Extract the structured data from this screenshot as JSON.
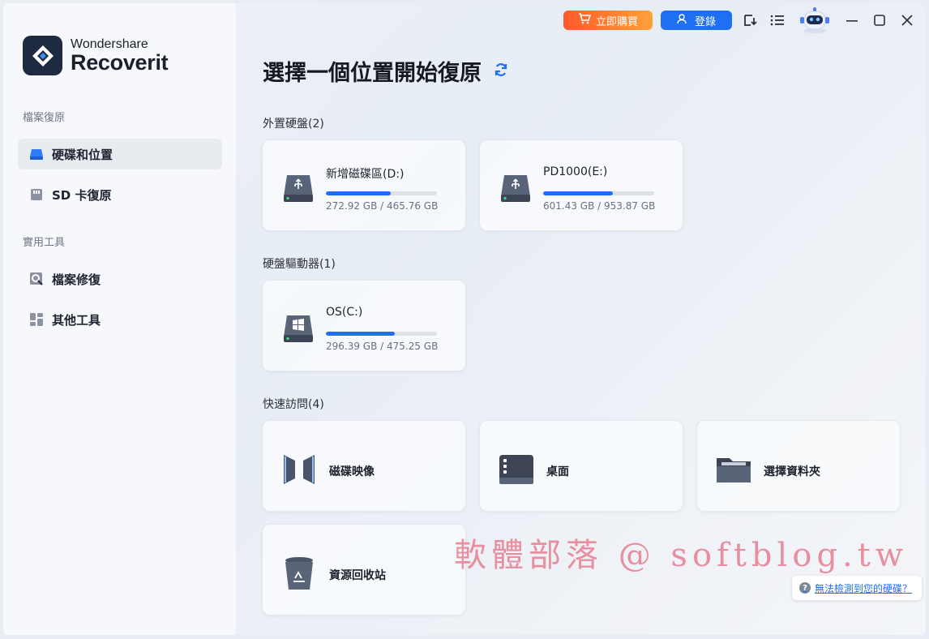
{
  "app": {
    "brand": "Wondershare",
    "product": "Recoverit"
  },
  "topbar": {
    "buy_label": "立即購買",
    "login_label": "登錄"
  },
  "sidebar": {
    "section_recover": "檔案復原",
    "section_tools": "實用工具",
    "items": [
      {
        "label": "硬碟和位置",
        "active": true
      },
      {
        "label": "SD 卡復原",
        "active": false
      },
      {
        "label": "檔案修復",
        "active": false
      },
      {
        "label": "其他工具",
        "active": false
      }
    ]
  },
  "main": {
    "title": "選擇一個位置開始復原",
    "external_label": "外置硬盤(2)",
    "internal_label": "硬盤驅動器(1)",
    "quick_label": "快速訪問(4)",
    "external_drives": [
      {
        "name": "新增磁碟區(D:)",
        "size": "272.92 GB / 465.76 GB",
        "used_fraction": 0.586
      },
      {
        "name": "PD1000(E:)",
        "size": "601.43 GB / 953.87 GB",
        "used_fraction": 0.63
      }
    ],
    "internal_drives": [
      {
        "name": "OS(C:)",
        "size": "296.39 GB / 475.25 GB",
        "used_fraction": 0.624
      }
    ],
    "quick_access": [
      {
        "label": "磁碟映像"
      },
      {
        "label": "桌面"
      },
      {
        "label": "選擇資料夾"
      },
      {
        "label": "資源回收站"
      }
    ]
  },
  "watermark": "軟體部落 @ softblog.tw",
  "help": {
    "q": "?",
    "label": "無法檢測到您的硬碟？"
  },
  "colors": {
    "accent": "#1e6ff1",
    "buy_start": "#ff5a2c",
    "buy_end": "#ffa13a"
  }
}
